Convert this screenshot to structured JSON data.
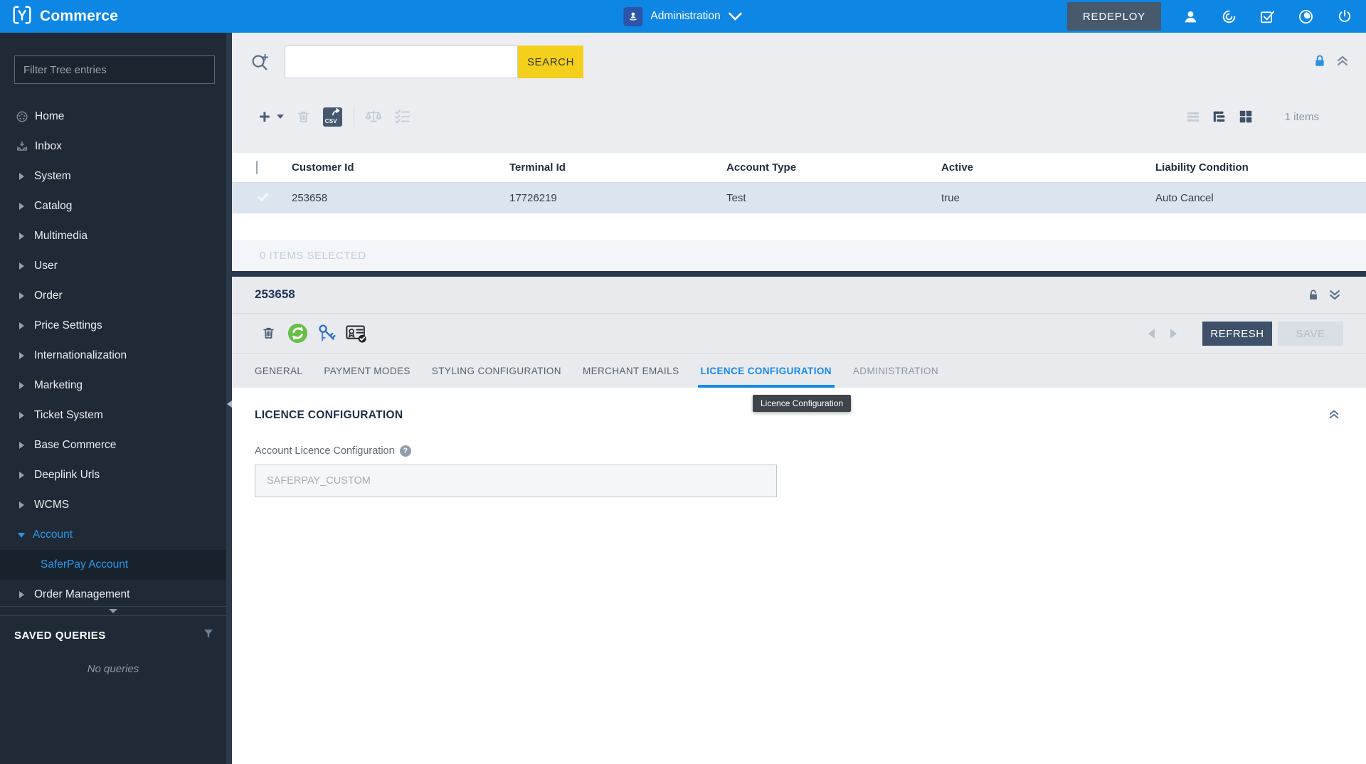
{
  "topbar": {
    "brand": "Commerce",
    "menu_label": "Administration",
    "redeploy_label": "REDEPLOY"
  },
  "sidebar": {
    "filter_placeholder": "Filter Tree entries",
    "items": [
      {
        "label": "Home"
      },
      {
        "label": "Inbox"
      },
      {
        "label": "System"
      },
      {
        "label": "Catalog"
      },
      {
        "label": "Multimedia"
      },
      {
        "label": "User"
      },
      {
        "label": "Order"
      },
      {
        "label": "Price Settings"
      },
      {
        "label": "Internationalization"
      },
      {
        "label": "Marketing"
      },
      {
        "label": "Ticket System"
      },
      {
        "label": "Base Commerce"
      },
      {
        "label": "Deeplink Urls"
      },
      {
        "label": "WCMS"
      },
      {
        "label": "Account"
      },
      {
        "label": "SaferPay Account"
      },
      {
        "label": "Order Management"
      }
    ],
    "saved_queries_title": "SAVED QUERIES",
    "saved_queries_empty": "No queries"
  },
  "list_panel": {
    "search_label": "SEARCH",
    "csv_label": "CSV",
    "items_count": "1 items",
    "selection_status": "0 ITEMS SELECTED",
    "columns": [
      "Customer Id",
      "Terminal Id",
      "Account Type",
      "Active",
      "Liability Condition"
    ],
    "rows": [
      {
        "customer_id": "253658",
        "terminal_id": "17726219",
        "account_type": "Test",
        "active": "true",
        "liability_condition": "Auto Cancel"
      }
    ]
  },
  "detail_panel": {
    "title": "253658",
    "refresh_label": "REFRESH",
    "save_label": "SAVE",
    "tabs": [
      {
        "label": "GENERAL"
      },
      {
        "label": "PAYMENT MODES"
      },
      {
        "label": "STYLING CONFIGURATION"
      },
      {
        "label": "MERCHANT EMAILS"
      },
      {
        "label": "LICENCE CONFIGURATION"
      },
      {
        "label": "ADMINISTRATION"
      }
    ],
    "active_tab": "LICENCE CONFIGURATION",
    "tooltip": "Licence Configuration",
    "section_title": "LICENCE CONFIGURATION",
    "field_label": "Account Licence Configuration",
    "field_value": "SAFERPAY_CUSTOM"
  },
  "colors": {
    "topbar_blue": "#0d86e4",
    "accent_blue": "#2f96e8",
    "search_yellow": "#f4d01c",
    "divider_navy": "#2a3b50",
    "row_selected_blue": "#dbe5ef",
    "button_navy": "#3e5168",
    "sync_green": "#67bf4a",
    "sidebar_navy": "#1f2a36"
  }
}
